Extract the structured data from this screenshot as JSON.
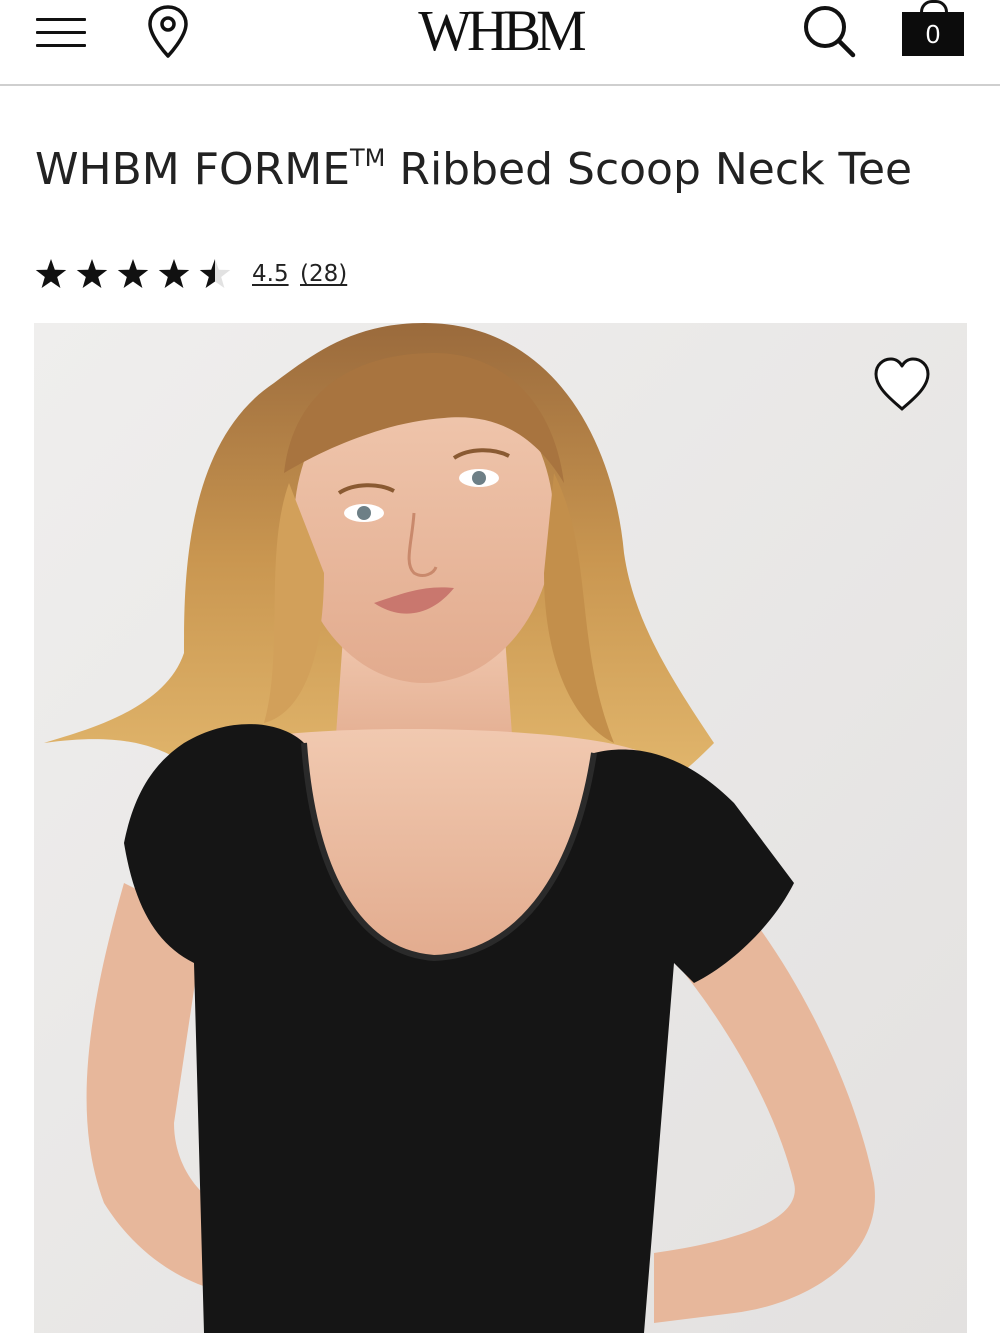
{
  "header": {
    "menu_icon": "hamburger-menu-icon",
    "location_icon": "map-pin-icon",
    "logo_text": "WHBM",
    "search_icon": "search-icon",
    "bag_icon": "shopping-bag-icon",
    "bag_count": "0"
  },
  "product": {
    "title": "WHBM FORME",
    "title_mark": "TM",
    "title_rest": " Ribbed Scoop Neck Tee",
    "rating": {
      "value": "4.5",
      "count": "(28)",
      "stars_filled": 4.5,
      "stars_total": 5
    },
    "image": {
      "description_icon": "product-photo",
      "wishlist_icon": "heart-icon"
    }
  },
  "colors": {
    "text": "#222222",
    "header_border": "#cfcfcf",
    "bag": "#0c0c0c",
    "image_bg": "#e9e7e6"
  }
}
